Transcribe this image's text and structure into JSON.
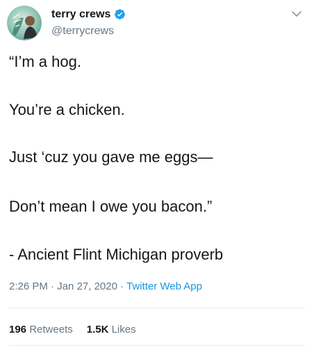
{
  "user": {
    "display_name": "terry crews",
    "handle": "@terrycrews",
    "verified": true,
    "avatar_icon": "avatar-image-icon"
  },
  "tweet": {
    "lines": [
      "“I’m a hog.",
      "You’re a chicken.",
      "Just ‘cuz you gave me eggs—",
      "Don’t mean I owe you bacon.”",
      "- Ancient Flint Michigan proverb"
    ],
    "time": "2:26 PM",
    "date": "Jan 27, 2020",
    "separator": "·",
    "source": "Twitter Web App"
  },
  "stats": {
    "retweets_count": "196",
    "retweets_label": "Retweets",
    "likes_count": "1.5K",
    "likes_label": "Likes"
  },
  "colors": {
    "text": "#14171a",
    "secondary": "#657786",
    "accent": "#1b95e0",
    "verified": "#1da1f2"
  }
}
